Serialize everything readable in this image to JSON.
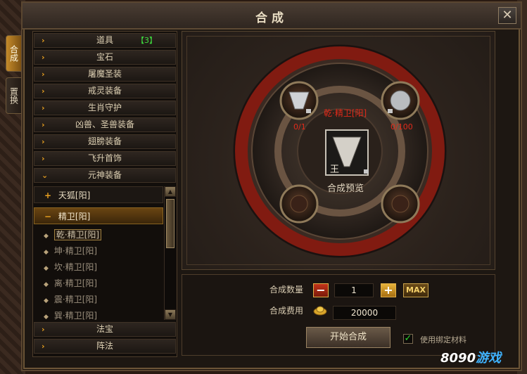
{
  "window": {
    "title": "合成",
    "close": "✕"
  },
  "sidetabs": [
    {
      "label": "合成",
      "active": true
    },
    {
      "label": "置换",
      "active": false
    }
  ],
  "categories_top": [
    {
      "label": "道具",
      "count": "【3】",
      "arrow": "›"
    },
    {
      "label": "宝石",
      "arrow": "›"
    },
    {
      "label": "屠魔圣装",
      "arrow": "›"
    },
    {
      "label": "戒灵装备",
      "arrow": "›"
    },
    {
      "label": "生肖守护",
      "arrow": "›"
    },
    {
      "label": "凶兽、圣兽装备",
      "arrow": "›"
    },
    {
      "label": "翅膀装备",
      "arrow": "›"
    },
    {
      "label": "飞升首饰",
      "arrow": "›"
    },
    {
      "label": "元神装备",
      "arrow": "⌄"
    }
  ],
  "subcategories": [
    {
      "label": "天狐[阳]",
      "sign": "+"
    },
    {
      "label": "精卫[阳]",
      "sign": "−"
    }
  ],
  "items": [
    {
      "label": "乾·精卫[阳]",
      "selected": true
    },
    {
      "label": "坤·精卫[阳]"
    },
    {
      "label": "坎·精卫[阳]"
    },
    {
      "label": "离·精卫[阳]"
    },
    {
      "label": "震·精卫[阳]"
    },
    {
      "label": "巽·精卫[阳]"
    }
  ],
  "categories_bottom": [
    {
      "label": "法宝",
      "arrow": "›"
    },
    {
      "label": "阵法",
      "arrow": "›"
    }
  ],
  "preview": {
    "target_name": "乾·精卫[阳]",
    "center_label": "王",
    "preview_label": "合成预览",
    "left_material_count": "0/1",
    "right_material_count": "0/100"
  },
  "controls": {
    "quantity_label": "合成数量",
    "quantity_value": "1",
    "minus": "−",
    "plus": "+",
    "max_label": "MAX",
    "cost_label": "合成费用",
    "cost_value": "20000",
    "start_label": "开始合成",
    "use_bound_label": "使用绑定材料",
    "use_bound_checked": true,
    "check_mark": "✓"
  },
  "watermark": {
    "part1": "8090",
    "part2": "游戏"
  },
  "colors": {
    "accent": "#e8a020",
    "red_label": "#e02a1a",
    "green_count": "#3fe03f"
  }
}
